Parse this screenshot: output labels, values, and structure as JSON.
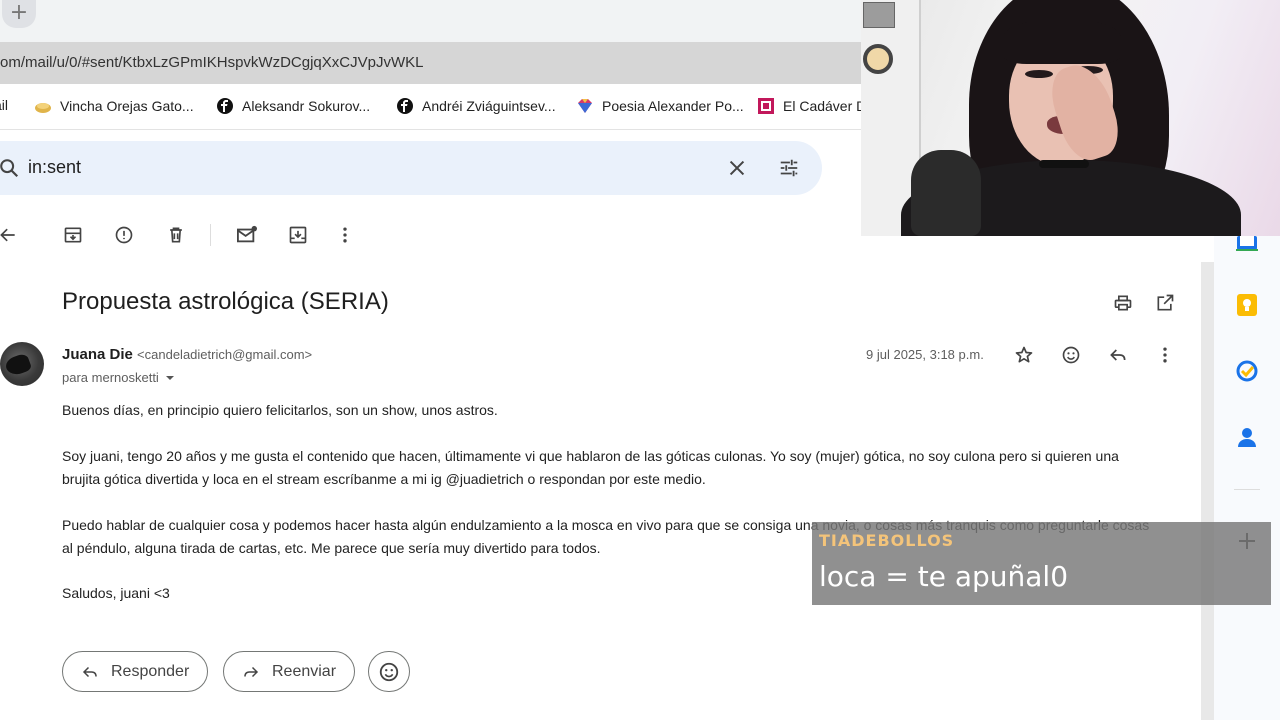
{
  "browser": {
    "new_tab_symbol": "+",
    "url": "om/mail/u/0/#sent/KtbxLzGPmIKHspvkWzDCgjqXxCJVpJvWKL",
    "bookmarks": [
      {
        "label": "ail",
        "icon": "gmail-icon"
      },
      {
        "label": "Vincha Orejas Gato...",
        "icon": "shop-icon"
      },
      {
        "label": "Aleksandr Sokurov...",
        "icon": "facebook-icon"
      },
      {
        "label": "Andréi Zviáguintsev...",
        "icon": "facebook-icon"
      },
      {
        "label": "Poesia Alexander Po...",
        "icon": "gem-icon"
      },
      {
        "label": "El Cadáver D",
        "icon": "grid-icon"
      }
    ]
  },
  "search": {
    "query": "in:sent",
    "icons": [
      "search-icon",
      "clear-icon",
      "tune-icon"
    ]
  },
  "toolbar": {
    "icons": [
      "back-arrow-icon",
      "archive-icon",
      "report-spam-icon",
      "delete-icon",
      "mark-unread-icon",
      "move-to-icon",
      "more-vert-icon"
    ]
  },
  "email": {
    "subject": "Propuesta astrológica (SERIA)",
    "sender_name": "Juana Die",
    "sender_email": "<candeladietrich@gmail.com>",
    "recipient": "para mernosketti",
    "date": "9 jul 2025, 3:18 p.m.",
    "body": [
      "Buenos días, en principio quiero felicitarlos, son un show, unos astros.",
      "Soy juani, tengo 20 años y me gusta el contenido que hacen, últimamente vi que hablaron de las góticas culonas. Yo soy (mujer) gótica, no soy culona pero si quieren una brujita gótica divertida y loca en el stream escríbanme a mi ig @juadietrich o respondan por este medio.",
      "Puedo hablar de cualquier cosa y podemos hacer hasta algún endulzamiento a la mosca en vivo para que se consiga una novia, o cosas más tranquis como preguntarle cosas al péndulo, alguna tirada de cartas, etc. Me parece que sería muy divertido para todos.",
      "Saludos, juani <3"
    ],
    "reply_label": "Responder",
    "forward_label": "Reenviar"
  },
  "side_panel": {
    "icons": [
      "calendar-icon",
      "keep-icon",
      "tasks-icon",
      "contacts-icon",
      "add-icon"
    ]
  },
  "chat": {
    "username": "TIADEBOLLOS",
    "message": "loca = te apuñal0"
  },
  "colors": {
    "search_bg": "#eaf1fb",
    "chat_username": "#f4c47a",
    "keep_yellow": "#fbbc04",
    "tasks_blue": "#1a73e8"
  }
}
